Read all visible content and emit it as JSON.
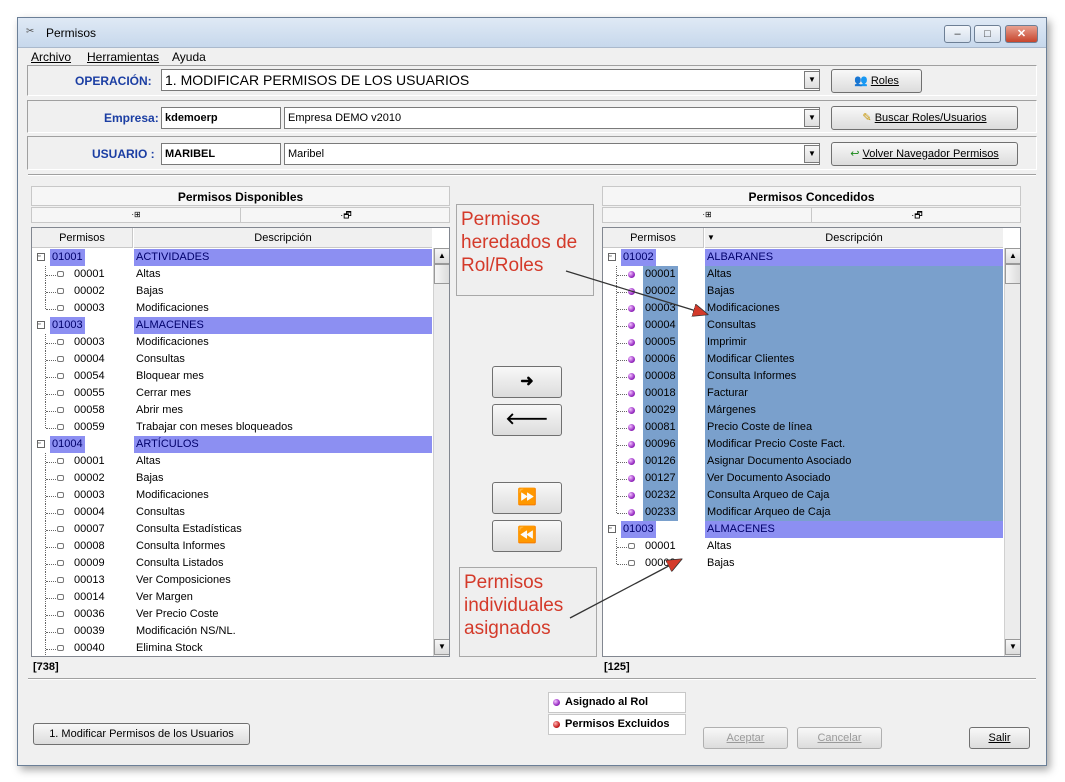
{
  "window": {
    "title": "Permisos"
  },
  "menu": [
    "Archivo",
    "Herramientas",
    "Ayuda"
  ],
  "operacion": {
    "label": "OPERACIÓN:",
    "value": "1. MODIFICAR PERMISOS DE LOS USUARIOS",
    "button": "Roles"
  },
  "empresa": {
    "label": "Empresa:",
    "code": "kdemoerp",
    "name": "Empresa DEMO v2010",
    "button": "Buscar Roles/Usuarios"
  },
  "usuario": {
    "label": "USUARIO :",
    "code": "MARIBEL",
    "name": "Maribel",
    "button": "Volver Navegador Permisos"
  },
  "disponibles": {
    "title": "Permisos Disponibles",
    "col_permisos": "Permisos",
    "col_descripcion": "Descripción",
    "count": "[738]",
    "rows": [
      {
        "type": "group",
        "code": "01001",
        "desc": "ACTIVIDADES"
      },
      {
        "type": "item",
        "code": "00001",
        "desc": "Altas"
      },
      {
        "type": "item",
        "code": "00002",
        "desc": "Bajas"
      },
      {
        "type": "item",
        "code": "00003",
        "desc": "Modificaciones",
        "last": true
      },
      {
        "type": "group",
        "code": "01003",
        "desc": "ALMACENES"
      },
      {
        "type": "item",
        "code": "00003",
        "desc": "Modificaciones"
      },
      {
        "type": "item",
        "code": "00004",
        "desc": "Consultas"
      },
      {
        "type": "item",
        "code": "00054",
        "desc": "Bloquear mes"
      },
      {
        "type": "item",
        "code": "00055",
        "desc": "Cerrar mes"
      },
      {
        "type": "item",
        "code": "00058",
        "desc": "Abrir mes"
      },
      {
        "type": "item",
        "code": "00059",
        "desc": "Trabajar con meses bloqueados",
        "last": true
      },
      {
        "type": "group",
        "code": "01004",
        "desc": "ARTÍCULOS"
      },
      {
        "type": "item",
        "code": "00001",
        "desc": "Altas"
      },
      {
        "type": "item",
        "code": "00002",
        "desc": "Bajas"
      },
      {
        "type": "item",
        "code": "00003",
        "desc": "Modificaciones"
      },
      {
        "type": "item",
        "code": "00004",
        "desc": "Consultas"
      },
      {
        "type": "item",
        "code": "00007",
        "desc": "Consulta Estadísticas"
      },
      {
        "type": "item",
        "code": "00008",
        "desc": "Consulta Informes"
      },
      {
        "type": "item",
        "code": "00009",
        "desc": "Consulta Listados"
      },
      {
        "type": "item",
        "code": "00013",
        "desc": "Ver Composiciones"
      },
      {
        "type": "item",
        "code": "00014",
        "desc": "Ver Margen"
      },
      {
        "type": "item",
        "code": "00036",
        "desc": "Ver Precio Coste"
      },
      {
        "type": "item",
        "code": "00039",
        "desc": "Modificación NS/NL."
      },
      {
        "type": "item",
        "code": "00040",
        "desc": "Elimina Stock"
      }
    ]
  },
  "concedidos": {
    "title": "Permisos Concedidos",
    "col_permisos": "Permisos",
    "col_descripcion": "Descripción",
    "count": "[125]",
    "rows": [
      {
        "type": "group",
        "code": "01002",
        "desc": "ALBARANES",
        "role": true
      },
      {
        "type": "item",
        "code": "00001",
        "desc": "Altas",
        "role": true
      },
      {
        "type": "item",
        "code": "00002",
        "desc": "Bajas",
        "role": true
      },
      {
        "type": "item",
        "code": "00003",
        "desc": "Modificaciones",
        "role": true
      },
      {
        "type": "item",
        "code": "00004",
        "desc": "Consultas",
        "role": true
      },
      {
        "type": "item",
        "code": "00005",
        "desc": "Imprimir",
        "role": true
      },
      {
        "type": "item",
        "code": "00006",
        "desc": "Modificar Clientes",
        "role": true
      },
      {
        "type": "item",
        "code": "00008",
        "desc": "Consulta Informes",
        "role": true
      },
      {
        "type": "item",
        "code": "00018",
        "desc": "Facturar",
        "role": true
      },
      {
        "type": "item",
        "code": "00029",
        "desc": "Márgenes",
        "role": true
      },
      {
        "type": "item",
        "code": "00081",
        "desc": "Precio Coste de línea",
        "role": true
      },
      {
        "type": "item",
        "code": "00096",
        "desc": "Modificar Precio Coste Fact.",
        "role": true
      },
      {
        "type": "item",
        "code": "00126",
        "desc": "Asignar Documento Asociado",
        "role": true
      },
      {
        "type": "item",
        "code": "00127",
        "desc": "Ver Documento Asociado",
        "role": true
      },
      {
        "type": "item",
        "code": "00232",
        "desc": "Consulta Arqueo de Caja",
        "role": true
      },
      {
        "type": "item",
        "code": "00233",
        "desc": "Modificar Arqueo de Caja",
        "role": true,
        "last": true
      },
      {
        "type": "group",
        "code": "01003",
        "desc": "ALMACENES",
        "role": true
      },
      {
        "type": "item",
        "code": "00001",
        "desc": "Altas",
        "role": false
      },
      {
        "type": "item",
        "code": "00002",
        "desc": "Bajas",
        "role": false,
        "last": true
      }
    ]
  },
  "annotations": {
    "heredados": "Permisos heredados de Rol/Roles",
    "individuales": "Permisos individuales asignados"
  },
  "legend": {
    "asignado": "Asignado al Rol",
    "excluidos": "Permisos Excluidos"
  },
  "footer": {
    "operation_button": "1. Modificar Permisos de los Usuarios",
    "aceptar": "Aceptar",
    "cancelar": "Cancelar",
    "salir": "Salir"
  },
  "colors": {
    "selection": "#8c8ff2",
    "role_highlight": "#7aa0cc",
    "label_blue": "#1b3ea3",
    "annotation_red": "#d43a2a"
  }
}
